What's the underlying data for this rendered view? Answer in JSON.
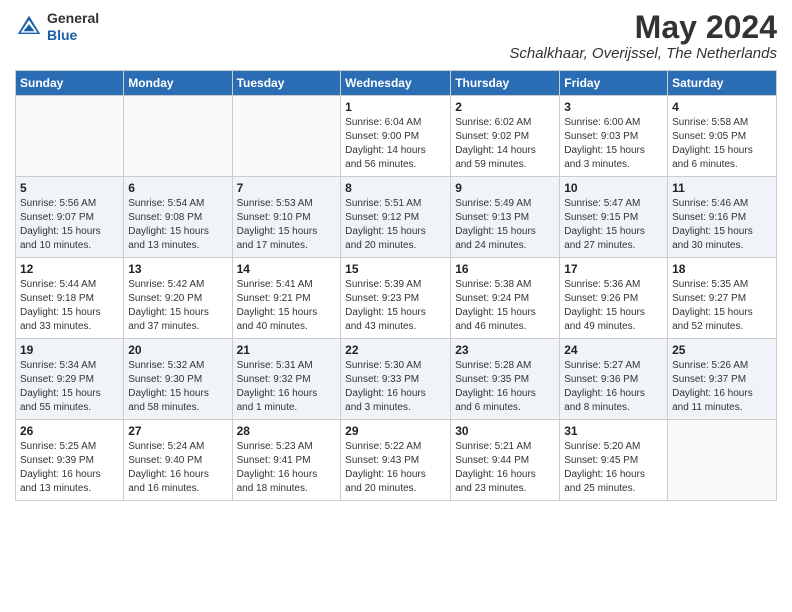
{
  "header": {
    "logo_line1": "General",
    "logo_line2": "Blue",
    "month_year": "May 2024",
    "location": "Schalkhaar, Overijssel, The Netherlands"
  },
  "weekdays": [
    "Sunday",
    "Monday",
    "Tuesday",
    "Wednesday",
    "Thursday",
    "Friday",
    "Saturday"
  ],
  "weeks": [
    [
      {
        "day": "",
        "info": ""
      },
      {
        "day": "",
        "info": ""
      },
      {
        "day": "",
        "info": ""
      },
      {
        "day": "1",
        "info": "Sunrise: 6:04 AM\nSunset: 9:00 PM\nDaylight: 14 hours\nand 56 minutes."
      },
      {
        "day": "2",
        "info": "Sunrise: 6:02 AM\nSunset: 9:02 PM\nDaylight: 14 hours\nand 59 minutes."
      },
      {
        "day": "3",
        "info": "Sunrise: 6:00 AM\nSunset: 9:03 PM\nDaylight: 15 hours\nand 3 minutes."
      },
      {
        "day": "4",
        "info": "Sunrise: 5:58 AM\nSunset: 9:05 PM\nDaylight: 15 hours\nand 6 minutes."
      }
    ],
    [
      {
        "day": "5",
        "info": "Sunrise: 5:56 AM\nSunset: 9:07 PM\nDaylight: 15 hours\nand 10 minutes."
      },
      {
        "day": "6",
        "info": "Sunrise: 5:54 AM\nSunset: 9:08 PM\nDaylight: 15 hours\nand 13 minutes."
      },
      {
        "day": "7",
        "info": "Sunrise: 5:53 AM\nSunset: 9:10 PM\nDaylight: 15 hours\nand 17 minutes."
      },
      {
        "day": "8",
        "info": "Sunrise: 5:51 AM\nSunset: 9:12 PM\nDaylight: 15 hours\nand 20 minutes."
      },
      {
        "day": "9",
        "info": "Sunrise: 5:49 AM\nSunset: 9:13 PM\nDaylight: 15 hours\nand 24 minutes."
      },
      {
        "day": "10",
        "info": "Sunrise: 5:47 AM\nSunset: 9:15 PM\nDaylight: 15 hours\nand 27 minutes."
      },
      {
        "day": "11",
        "info": "Sunrise: 5:46 AM\nSunset: 9:16 PM\nDaylight: 15 hours\nand 30 minutes."
      }
    ],
    [
      {
        "day": "12",
        "info": "Sunrise: 5:44 AM\nSunset: 9:18 PM\nDaylight: 15 hours\nand 33 minutes."
      },
      {
        "day": "13",
        "info": "Sunrise: 5:42 AM\nSunset: 9:20 PM\nDaylight: 15 hours\nand 37 minutes."
      },
      {
        "day": "14",
        "info": "Sunrise: 5:41 AM\nSunset: 9:21 PM\nDaylight: 15 hours\nand 40 minutes."
      },
      {
        "day": "15",
        "info": "Sunrise: 5:39 AM\nSunset: 9:23 PM\nDaylight: 15 hours\nand 43 minutes."
      },
      {
        "day": "16",
        "info": "Sunrise: 5:38 AM\nSunset: 9:24 PM\nDaylight: 15 hours\nand 46 minutes."
      },
      {
        "day": "17",
        "info": "Sunrise: 5:36 AM\nSunset: 9:26 PM\nDaylight: 15 hours\nand 49 minutes."
      },
      {
        "day": "18",
        "info": "Sunrise: 5:35 AM\nSunset: 9:27 PM\nDaylight: 15 hours\nand 52 minutes."
      }
    ],
    [
      {
        "day": "19",
        "info": "Sunrise: 5:34 AM\nSunset: 9:29 PM\nDaylight: 15 hours\nand 55 minutes."
      },
      {
        "day": "20",
        "info": "Sunrise: 5:32 AM\nSunset: 9:30 PM\nDaylight: 15 hours\nand 58 minutes."
      },
      {
        "day": "21",
        "info": "Sunrise: 5:31 AM\nSunset: 9:32 PM\nDaylight: 16 hours\nand 1 minute."
      },
      {
        "day": "22",
        "info": "Sunrise: 5:30 AM\nSunset: 9:33 PM\nDaylight: 16 hours\nand 3 minutes."
      },
      {
        "day": "23",
        "info": "Sunrise: 5:28 AM\nSunset: 9:35 PM\nDaylight: 16 hours\nand 6 minutes."
      },
      {
        "day": "24",
        "info": "Sunrise: 5:27 AM\nSunset: 9:36 PM\nDaylight: 16 hours\nand 8 minutes."
      },
      {
        "day": "25",
        "info": "Sunrise: 5:26 AM\nSunset: 9:37 PM\nDaylight: 16 hours\nand 11 minutes."
      }
    ],
    [
      {
        "day": "26",
        "info": "Sunrise: 5:25 AM\nSunset: 9:39 PM\nDaylight: 16 hours\nand 13 minutes."
      },
      {
        "day": "27",
        "info": "Sunrise: 5:24 AM\nSunset: 9:40 PM\nDaylight: 16 hours\nand 16 minutes."
      },
      {
        "day": "28",
        "info": "Sunrise: 5:23 AM\nSunset: 9:41 PM\nDaylight: 16 hours\nand 18 minutes."
      },
      {
        "day": "29",
        "info": "Sunrise: 5:22 AM\nSunset: 9:43 PM\nDaylight: 16 hours\nand 20 minutes."
      },
      {
        "day": "30",
        "info": "Sunrise: 5:21 AM\nSunset: 9:44 PM\nDaylight: 16 hours\nand 23 minutes."
      },
      {
        "day": "31",
        "info": "Sunrise: 5:20 AM\nSunset: 9:45 PM\nDaylight: 16 hours\nand 25 minutes."
      },
      {
        "day": "",
        "info": ""
      }
    ]
  ]
}
